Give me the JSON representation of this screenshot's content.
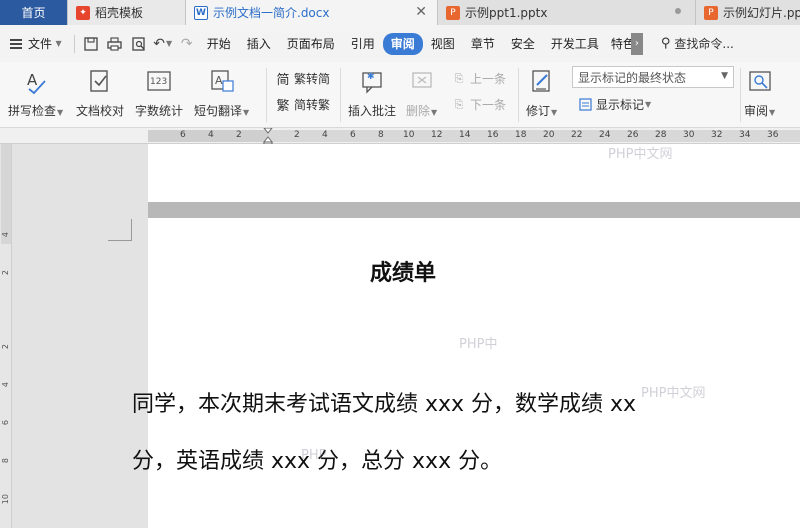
{
  "tabs": {
    "home": "首页",
    "template": "稻壳模板",
    "doc": "示例文档一简介.docx",
    "ppt1": "示例ppt1.pptx",
    "ppt2": "示例幻灯片.pp"
  },
  "menu": {
    "file": "文件",
    "items": [
      "开始",
      "插入",
      "页面布局",
      "引用",
      "审阅",
      "视图",
      "章节",
      "安全",
      "开发工具",
      "特色"
    ],
    "active": "审阅",
    "search": "查找命令..."
  },
  "ribbon": {
    "spell_check": "拼写检查",
    "doc_proof": "文档校对",
    "word_count": "字数统计",
    "translate": "短句翻译",
    "trad_to_simp": "繁转简",
    "simp_to_trad": "简转繁",
    "insert_comment": "插入批注",
    "delete": "删除",
    "prev": "上一条",
    "next": "下一条",
    "revise": "修订",
    "markup_dropdown": "显示标记的最终状态",
    "show_markup": "显示标记",
    "review": "审阅"
  },
  "ruler": {
    "left_ticks": [
      "6",
      "4",
      "2"
    ],
    "right_ticks": [
      "2",
      "4",
      "6",
      "8",
      "10",
      "12",
      "14",
      "16",
      "18",
      "20",
      "22",
      "24",
      "26",
      "28",
      "30",
      "32",
      "34",
      "36"
    ],
    "vertical_ticks": [
      "4",
      "2",
      "2",
      "4",
      "6",
      "8",
      "10"
    ]
  },
  "document": {
    "title": "成绩单",
    "line1": "同学，本次期末考试语文成绩 xxx 分，数学成绩 xx",
    "line2": "分，英语成绩 xxx 分，总分 xxx 分。"
  },
  "watermarks": [
    "PHP中文网",
    "PHP中",
    "PHP中文网",
    "PHP"
  ],
  "colors": {
    "home_tab": "#2c5aa0",
    "active_menu": "#3a7bd5",
    "doc_tab_text": "#2b6dc8"
  }
}
